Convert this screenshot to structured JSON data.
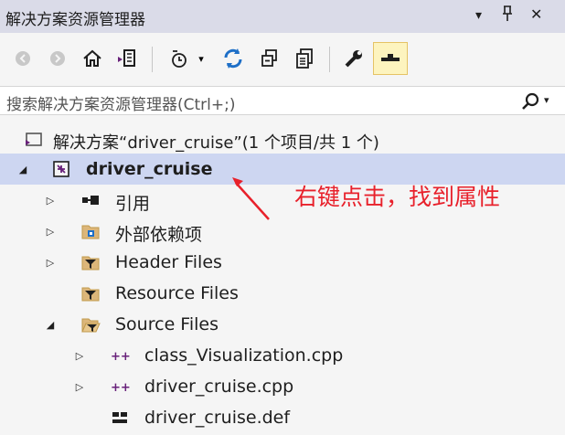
{
  "window": {
    "title": "解决方案资源管理器",
    "controls": {
      "dropdown": "▾",
      "pin": "ꟼ",
      "close": "✕"
    }
  },
  "toolbar": {
    "buttons": [
      "back-icon",
      "forward-icon",
      "home-icon",
      "switch-views-icon",
      "pending-changes-filter-icon",
      "sync-icon",
      "collapse-all-icon",
      "show-all-files-icon",
      "properties-icon",
      "preview-icon"
    ]
  },
  "search": {
    "placeholder": "搜索解决方案资源管理器(Ctrl+;)",
    "icon": "search-icon"
  },
  "tree": {
    "solution": {
      "label": "解决方案“driver_cruise”(1 个项目/共 1 个)"
    },
    "project": {
      "label": "driver_cruise",
      "expanded": true,
      "selected": true
    },
    "items": [
      {
        "label": "引用",
        "icon": "references-icon",
        "expanded": false
      },
      {
        "label": "外部依赖项",
        "icon": "external-dependencies-icon",
        "expanded": false
      },
      {
        "label": "Header Files",
        "icon": "filter-folder-icon",
        "expanded": false
      },
      {
        "label": "Resource Files",
        "icon": "filter-folder-icon",
        "expanded": null
      },
      {
        "label": "Source Files",
        "icon": "filter-folder-open-icon",
        "expanded": true
      }
    ],
    "files": [
      {
        "label": "class_Visualization.cpp",
        "icon": "cpp-file-icon",
        "expanded": false
      },
      {
        "label": "driver_cruise.cpp",
        "icon": "cpp-file-icon",
        "expanded": false
      },
      {
        "label": "driver_cruise.def",
        "icon": "def-file-icon",
        "expanded": null
      }
    ]
  },
  "annotation": {
    "text": "右键点击，找到属性",
    "color": "#e8212b"
  },
  "colors": {
    "selection": "#cdd6f1",
    "titlebar": "#dadbe8",
    "accent": "#68217a",
    "sync": "#1e6fc7"
  }
}
